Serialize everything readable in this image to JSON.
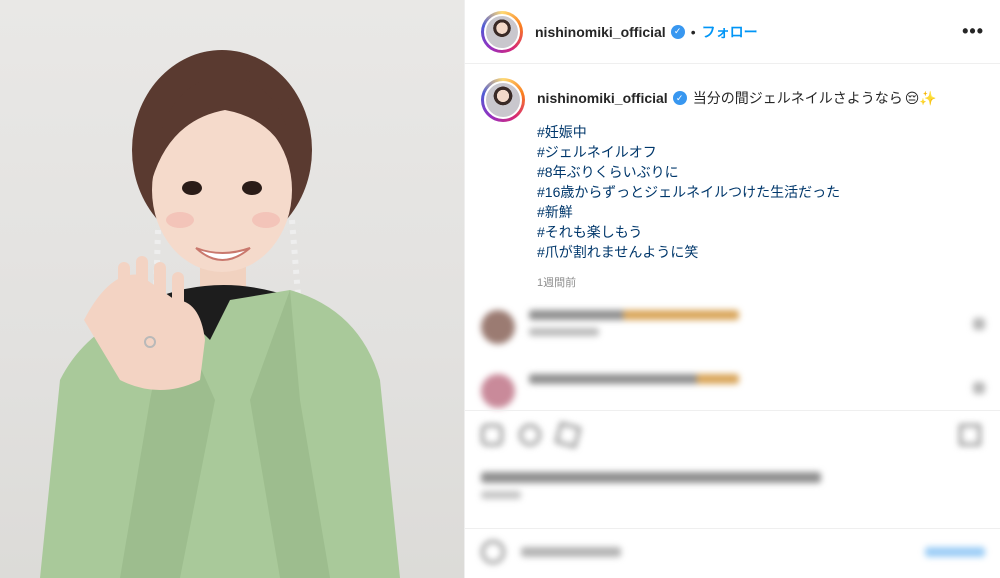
{
  "header": {
    "username": "nishinomiki_official",
    "separator": "•",
    "follow_label": "フォロー",
    "more_icon": "ellipsis-icon"
  },
  "caption": {
    "username": "nishinomiki_official",
    "text": "当分の間ジェルネイルさようなら",
    "emojis": "😔✨",
    "hashtags": [
      "#妊娠中",
      "#ジェルネイルオフ",
      "#8年ぶりくらいぶりに",
      "#16歳からずっとジェルネイルつけた生活だった",
      "#新鮮",
      "#それも楽しもう",
      "#爪が割れませんように笑"
    ],
    "time": "1週間前"
  },
  "colors": {
    "follow": "#0095f6",
    "hashtag": "#00376b",
    "verified": "#3897f0",
    "jacket": "#a9c99a"
  }
}
